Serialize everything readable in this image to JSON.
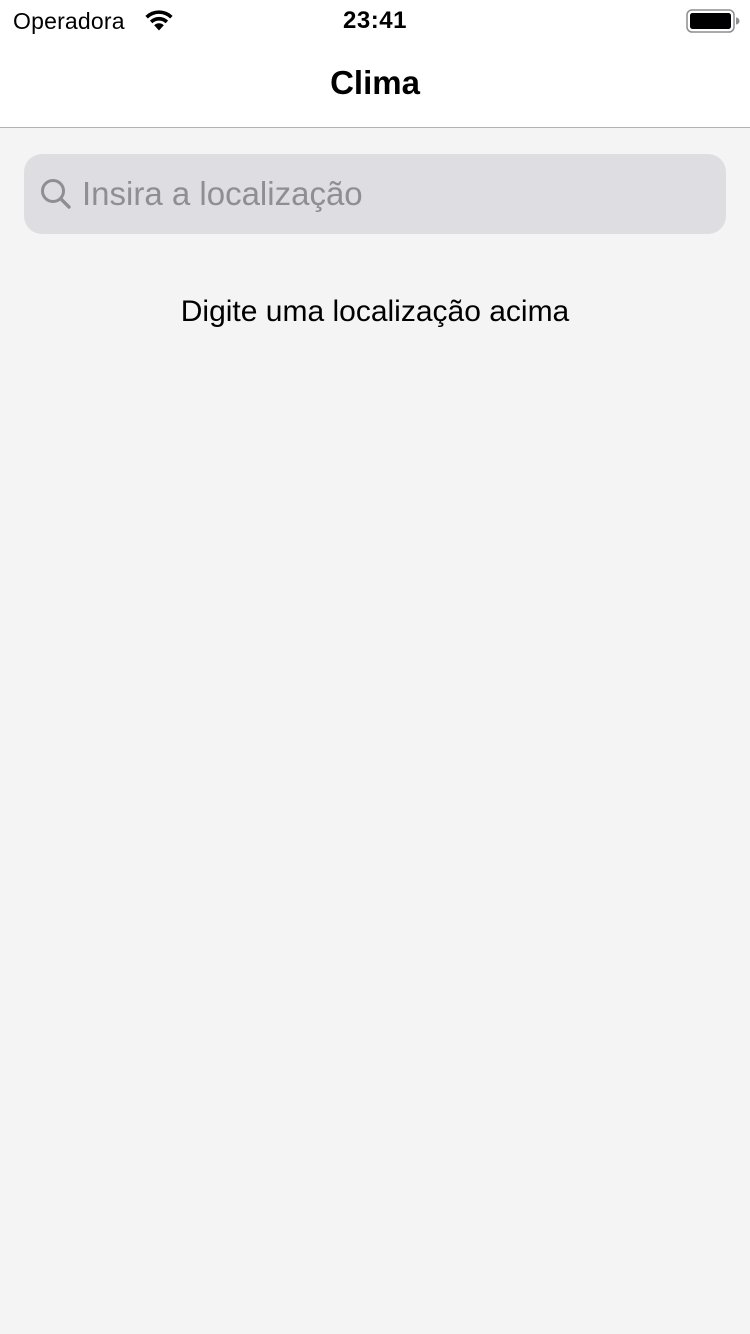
{
  "status_bar": {
    "carrier": "Operadora",
    "time": "23:41",
    "wifi_icon": "wifi-icon",
    "battery_icon": "battery-full-icon",
    "battery_level": 1.0
  },
  "nav": {
    "title": "Clima"
  },
  "search": {
    "placeholder": "Insira a localização",
    "value": "",
    "icon": "search-icon"
  },
  "content": {
    "empty_message": "Digite uma localização acima"
  },
  "colors": {
    "background": "#f4f4f4",
    "bar_background": "#ffffff",
    "search_field": "#dedee2",
    "placeholder": "#8e8e93",
    "divider": "#b2b2b2"
  }
}
